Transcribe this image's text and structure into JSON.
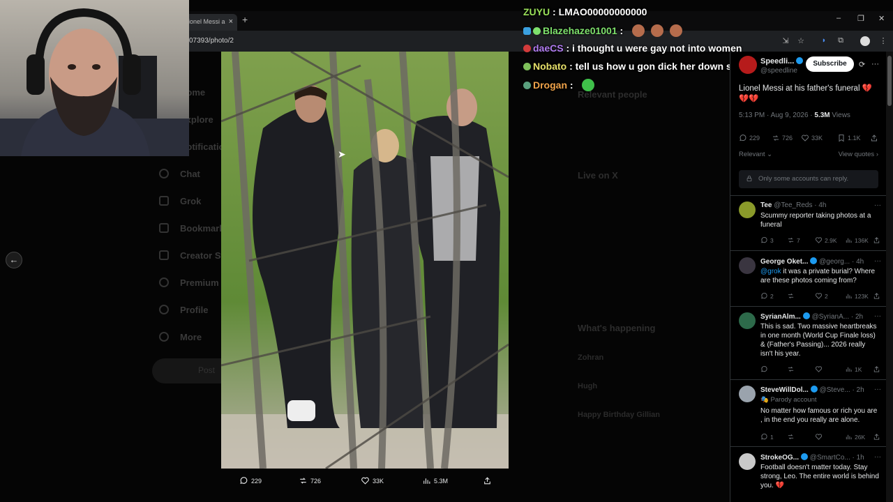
{
  "browser": {
    "tab_title": "ionel Messi a",
    "url": "07393/photo/2"
  },
  "background_nav": [
    "Home",
    "Explore",
    "Notifications",
    "Chat",
    "Grok",
    "Bookmarks",
    "Creator Studio",
    "Premium",
    "Profile",
    "More"
  ],
  "background_post": "Post",
  "background_right": {
    "relevant_title": "Relevant people",
    "live_title": "Live on X",
    "happening_title": "What's happening",
    "happening_items": [
      "Zohran",
      "Hugh",
      "Happy Birthday Gillian"
    ]
  },
  "chat": [
    {
      "user": "ZUYU",
      "color": "#9ae05a",
      "message": "LMAO00000000000",
      "emotes": 0
    },
    {
      "user": "Blazehaze01001",
      "color": "#7ee06c",
      "message": "",
      "emotes": 3
    },
    {
      "user": "daeCS",
      "color": "#b07cf0",
      "message": "i thought u were gay not into women",
      "emotes": 0
    },
    {
      "user": "Nobato",
      "color": "#e6e06a",
      "message": "tell us how u gon dick her down slik",
      "emotes": 0
    },
    {
      "user": "Drogan",
      "color": "#f0a34a",
      "message": "",
      "emotes": 1
    }
  ],
  "photo_stats": {
    "replies": "229",
    "reposts": "726",
    "likes": "33K",
    "views": "5.3M"
  },
  "tweet": {
    "author": "Speedli...",
    "handle": "@speedline",
    "subscribe": "Subscribe",
    "text": "Lionel Messi at his father's funeral 💔💔💔",
    "time": "5:13 PM · Aug 9, 2026 · ",
    "views": "5.3M",
    "views_label": " Views",
    "replies": "229",
    "reposts": "726",
    "likes": "33K",
    "bookmarks": "1.1K",
    "sort": "Relevant",
    "view_quotes": "View quotes",
    "only_accounts": "Only some accounts can reply."
  },
  "replies": [
    {
      "name": "Tee",
      "handle": "@Tee_Reds · 4h",
      "text": "Scummy reporter taking photos at a funeral",
      "mention": "",
      "replies": "3",
      "reposts": "7",
      "likes": "2.9K",
      "views": "136K",
      "avatar": "#8a9a2a",
      "parody": ""
    },
    {
      "name": "George Oket...",
      "handle": "@georg... · 4h",
      "text": " it was a private burial? Where are these photos coming from?",
      "mention": "@grok",
      "replies": "2",
      "reposts": "",
      "likes": "2",
      "views": "123K",
      "avatar": "#3a3540",
      "parody": ""
    },
    {
      "name": "SyrianAlm...",
      "handle": "@SyrianA... · 2h",
      "text": "This is sad. Two massive heartbreaks in one month (World Cup Finale loss) & (Father's Passing)... 2026 really isn't his year.",
      "mention": "",
      "replies": "",
      "reposts": "",
      "likes": "",
      "views": "1K",
      "avatar": "#2d6a4a",
      "parody": ""
    },
    {
      "name": "SteveWillDol...",
      "handle": "@Steve... · 2h",
      "text": "No matter how famous or rich you are , in the end you really are alone.",
      "mention": "",
      "replies": "1",
      "reposts": "",
      "likes": "",
      "views": "26K",
      "avatar": "#9aa3ad",
      "parody": "Parody account"
    },
    {
      "name": "StrokeOG...",
      "handle": "@SmartCo... · 1h",
      "text": "Football doesn't matter today. Stay strong, Leo. The entire world is behind you. 💔",
      "mention": "",
      "replies": "",
      "reposts": "",
      "likes": "",
      "views": "",
      "avatar": "#c9c9c9",
      "parody": ""
    }
  ]
}
